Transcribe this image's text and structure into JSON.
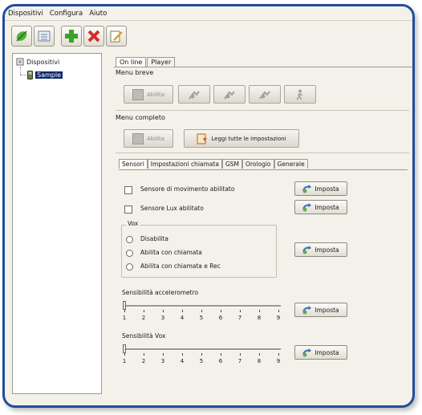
{
  "menubar": {
    "items": [
      "Dispositivi",
      "Configura",
      "Aiuto"
    ]
  },
  "toolbar": {
    "icons": [
      "connect-icon",
      "list-icon",
      "add-icon",
      "delete-icon",
      "edit-icon"
    ]
  },
  "tree": {
    "root": "Dispositivi",
    "child": "Sample"
  },
  "tabs": [
    "On line",
    "Player"
  ],
  "menu_breve": {
    "label": "Menu breve",
    "abilita": "Abilita"
  },
  "menu_completo": {
    "label": "Menu completo",
    "abilita": "Abilita",
    "leggi": "Leggi tutte le impostazioni"
  },
  "subtabs": [
    "Sensori",
    "Impostazioni chiamata",
    "GSM",
    "Orologio",
    "Generale"
  ],
  "sensori": {
    "movimento": "Sensore di movimento abilitato",
    "lux": "Sensore Lux abilitato",
    "vox_title": "Vox",
    "vox_options": [
      "Disabilita",
      "Abilita con chiamata",
      "Abilita con chiamata e Rec"
    ],
    "acc_label": "Sensibilità accelerometro",
    "vox_label": "Sensibilità Vox",
    "ticks": [
      "1",
      "2",
      "3",
      "4",
      "5",
      "6",
      "7",
      "8",
      "9"
    ],
    "imposta": "Imposta"
  }
}
